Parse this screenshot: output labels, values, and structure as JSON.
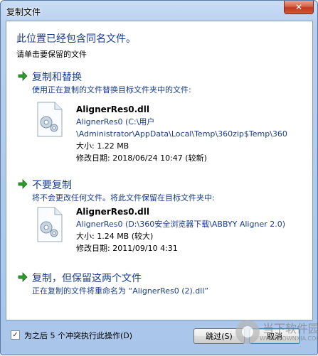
{
  "window": {
    "title": "复制文件",
    "close_glyph": "✕"
  },
  "dialog": {
    "heading": "此位置已经包含同名文件。",
    "subheading": "请单击要保留的文件"
  },
  "options": [
    {
      "title": "复制和替换",
      "description": "使用正在复制的文件替换目标文件夹中的文件:",
      "file": {
        "name": "AlignerRes0.dll",
        "path_line1": "AlignerRes0 (C:\\用户",
        "path_line2": "\\Administrator\\AppData\\Local\\Temp\\360zip$Temp\\360",
        "size": "大小: 1.22 MB",
        "modified": "修改日期: 2018/06/24  10:47 (较新)"
      }
    },
    {
      "title": "不要复制",
      "description": "将不会更改任何文件。将此文件保留在目标文件夹中:",
      "file": {
        "name": "AlignerRes0.dll",
        "path_line1": "AlignerRes0 (D:\\360安全浏览器下载\\ABBYY Aligner 2.0)",
        "size": "大小: 1.24 MB (较大)",
        "modified": "修改日期: 2011/09/10  4:31"
      }
    },
    {
      "title": "复制，但保留这两个文件",
      "description": "正在复制的文件将重命名为 “AlignerRes0 (2).dll”"
    }
  ],
  "footer": {
    "checkbox_label": "为之后 5 个冲突执行此操作(D)",
    "checkbox_checked": true,
    "checkbox_glyph": "✓",
    "skip_label": "跳过(S)",
    "cancel_label": "取消"
  },
  "watermark": {
    "text": "当下软件园",
    "sub": "WWW.DOWNXIA.COM"
  },
  "colors": {
    "link_blue": "#1a3e8c",
    "arrow_green": "#2e9a2e"
  }
}
